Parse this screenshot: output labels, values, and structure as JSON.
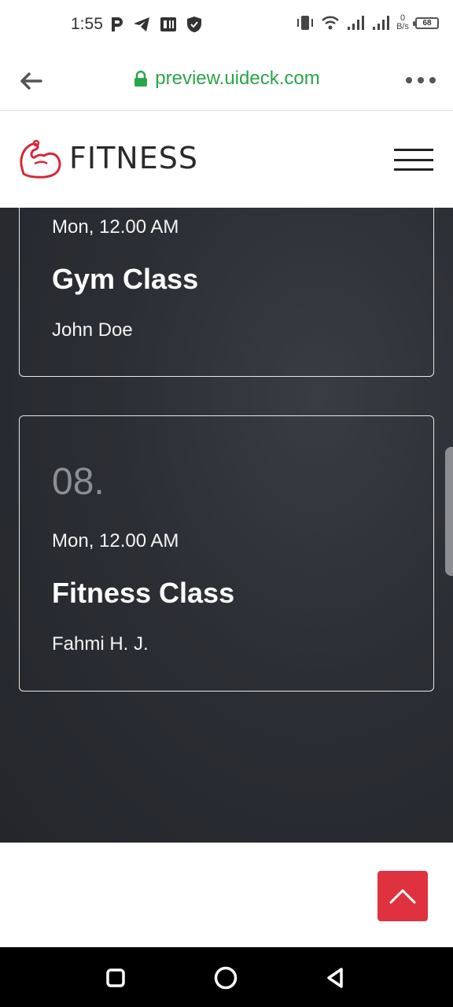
{
  "status_bar": {
    "time": "1:55",
    "net_speed_value": "0",
    "net_speed_unit": "B/s",
    "battery": "68"
  },
  "browser": {
    "url": "preview.uideck.com"
  },
  "site": {
    "logo_text": "FITNESS"
  },
  "classes": [
    {
      "time": "Mon, 12.00 AM",
      "title": "Gym Class",
      "trainer": "John Doe"
    },
    {
      "number": "08.",
      "time": "Mon, 12.00 AM",
      "title": "Fitness Class",
      "trainer": "Fahmi H. J."
    }
  ],
  "colors": {
    "accent": "#e0323e",
    "url_green": "#2aa54a",
    "dark_bg": "#2c2e35"
  },
  "icons": {
    "back": "arrow-left-icon",
    "lock": "lock-icon",
    "more": "more-dots-icon",
    "menu": "hamburger-icon",
    "logo": "flexed-arm-icon",
    "back_to_top": "chevron-up-icon",
    "nav_recents": "square-icon",
    "nav_home": "circle-icon",
    "nav_back": "triangle-back-icon"
  }
}
